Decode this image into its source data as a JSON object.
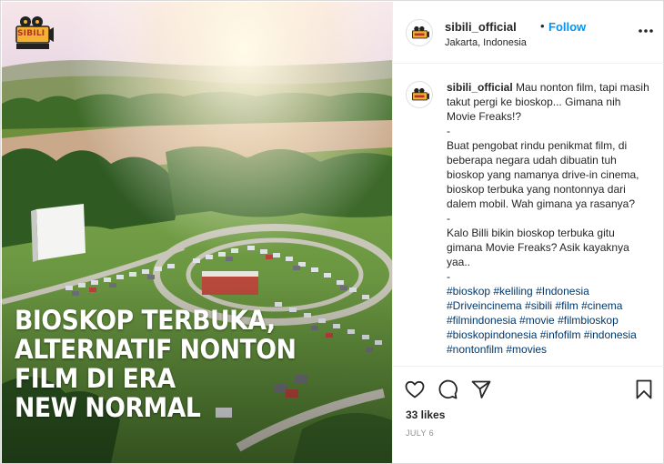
{
  "post": {
    "brand_logo_text": "SIBILI",
    "headline_lines": [
      "BIOSKOP TERBUKA,",
      "ALTERNATIF NONTON",
      "FILM DI ERA",
      "NEW NORMAL"
    ]
  },
  "header": {
    "username": "sibili_official",
    "separator": "•",
    "follow_label": "Follow",
    "location": "Jakarta, Indonesia",
    "more_icon": "more-horizontal-icon"
  },
  "caption": {
    "username": "sibili_official",
    "lines": [
      "Mau nonton film, tapi masih takut pergi ke bioskop... Gimana nih Movie Freaks!?",
      "-",
      "Buat pengobat rindu penikmat film, di beberapa negara udah dibuatin tuh bioskop yang namanya drive-in cinema, bioskop terbuka yang nontonnya dari dalem mobil. Wah gimana ya rasanya?",
      "-",
      "Kalo Billi bikin bioskop terbuka gitu gimana Movie Freaks? Asik kayaknya yaa..",
      "-"
    ],
    "hashtags": [
      "#bioskop",
      "#keliling",
      "#Indonesia",
      "#Driveincinema",
      "#sibili",
      "#film",
      "#cinema",
      "#filmindonesia",
      "#movie",
      "#filmbioskop",
      "#bioskopindonesia",
      "#infofilm",
      "#indonesia",
      "#nontonfilm",
      "#movies"
    ]
  },
  "actions": {
    "icons": [
      "heart-icon",
      "comment-icon",
      "share-icon",
      "bookmark-icon"
    ],
    "likes": "33 likes",
    "date": "JULY 6"
  },
  "colors": {
    "link_blue": "#0095f6",
    "hashtag": "#00376b",
    "muted": "#8e8e8e",
    "border": "#dbdbdb"
  }
}
